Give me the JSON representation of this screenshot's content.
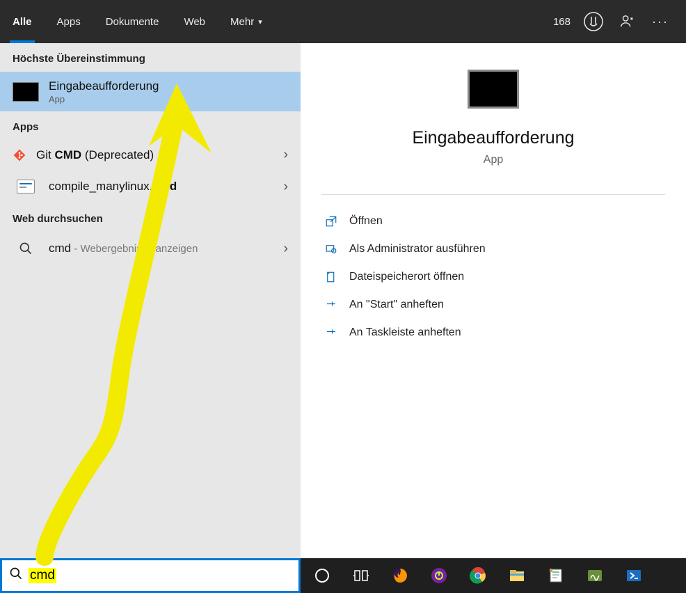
{
  "tabs": {
    "all": "Alle",
    "apps": "Apps",
    "documents": "Dokumente",
    "web": "Web",
    "more": "Mehr"
  },
  "header": {
    "points": "168"
  },
  "left": {
    "best_match_header": "Höchste Übereinstimmung",
    "best_match": {
      "title": "Eingabeaufforderung",
      "subtitle": "App"
    },
    "apps_header": "Apps",
    "app_results": [
      {
        "prefix": "Git ",
        "bold": "CMD",
        "suffix": " (Deprecated)"
      },
      {
        "prefix": "compile_manylinux.",
        "bold": "cmd",
        "suffix": ""
      }
    ],
    "web_header": "Web durchsuchen",
    "web_result": {
      "query": "cmd",
      "hint": " - Webergebnisse anzeigen"
    }
  },
  "detail": {
    "title": "Eingabeaufforderung",
    "subtitle": "App",
    "actions": {
      "open": "Öffnen",
      "admin": "Als Administrator ausführen",
      "location": "Dateispeicherort öffnen",
      "pin_start": "An \"Start\" anheften",
      "pin_taskbar": "An Taskleiste anheften"
    }
  },
  "search": {
    "value": "cmd"
  }
}
